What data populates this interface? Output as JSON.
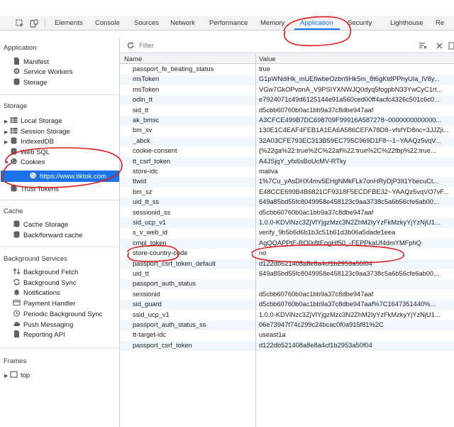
{
  "toolbar": {
    "tabs": [
      "Elements",
      "Console",
      "Sources",
      "Network",
      "Performance",
      "Memory",
      "Application",
      "Security",
      "Lighthouse",
      "Re"
    ],
    "active_tab": "Application",
    "filter_placeholder": "Filter",
    "accent": "#1a73e8",
    "annotation_color": "#e0191c"
  },
  "sidebar": {
    "application": {
      "title": "Application",
      "items": [
        {
          "label": "Manifest",
          "icon": "document-icon"
        },
        {
          "label": "Service Workers",
          "icon": "gear-icon"
        },
        {
          "label": "Storage",
          "icon": "database-icon"
        }
      ]
    },
    "storage": {
      "title": "Storage",
      "items": [
        {
          "label": "Local Storage",
          "icon": "grid-icon"
        },
        {
          "label": "Session Storage",
          "icon": "grid-icon"
        },
        {
          "label": "IndexedDB",
          "icon": "database-icon"
        },
        {
          "label": "Web SQL",
          "icon": "database-icon"
        },
        {
          "label": "Cookies",
          "icon": "cookie-icon"
        },
        {
          "label": "https://www.tiktok.com",
          "icon": "cookie-icon"
        },
        {
          "label": "Trust Tokens",
          "icon": "database-icon"
        }
      ]
    },
    "cache": {
      "title": "Cache",
      "items": [
        {
          "label": "Cache Storage",
          "icon": "database-icon"
        },
        {
          "label": "Back/forward cache",
          "icon": "database-icon"
        }
      ]
    },
    "background": {
      "title": "Background Services",
      "items": [
        {
          "label": "Background Fetch",
          "icon": "arrows-icon"
        },
        {
          "label": "Background Sync",
          "icon": "sync-icon"
        },
        {
          "label": "Notifications",
          "icon": "bell-icon"
        },
        {
          "label": "Payment Handler",
          "icon": "card-icon"
        },
        {
          "label": "Periodic Background Sync",
          "icon": "clock-icon"
        },
        {
          "label": "Push Messaging",
          "icon": "cloud-icon"
        },
        {
          "label": "Reporting API",
          "icon": "document-icon"
        }
      ]
    },
    "frames": {
      "title": "Frames",
      "items": [
        {
          "label": "top",
          "icon": "frame-icon"
        }
      ]
    }
  },
  "table": {
    "headers": {
      "name": "Name",
      "value": "Value"
    },
    "rows": [
      {
        "name": "passport_fe_beating_status",
        "value": "true"
      },
      {
        "name": "msToken",
        "value": "G1pWNdiHk_mUEfiwbeOzbn9Hk5m_8t6gKtdPPhyUla_lV8y..."
      },
      {
        "name": "msToken",
        "value": "VGw7GkOPvonA_V9PSIYXNWJQ0dyq5fogpbN33YwCyC1rt..."
      },
      {
        "name": "odin_tt",
        "value": "e7924071c49d6125144e91a560ced00ff4acfc4326c501c6c0..."
      },
      {
        "name": "sid_tt",
        "value": "d5cbb60760b0ac1bb9a37c8dbe947aaf"
      },
      {
        "name": "ak_bmsc",
        "value": "A3CFCE499B7DC698709F99916A587278~0000000000000..."
      },
      {
        "name": "bm_sv",
        "value": "130E1C4EAF4FEB1A1EA6A586CEFA78D8~vfsfYD8nc+3JJZji..."
      },
      {
        "name": "_abck",
        "value": "32A03CFE793EC313B59EC795C969D1F8~-1~YAAQz5vqV..."
      },
      {
        "name": "cookie-consent",
        "value": "{%22ga%22:true%2C%22af%22:true%2C%22fbp%22:true..."
      },
      {
        "name": "tt_csrf_token",
        "value": "A4JSjqY_yfx6sBoUcMV-RTky"
      },
      {
        "name": "store-idc",
        "value": "maliva"
      },
      {
        "name": "ttwid",
        "value": "1%7Cu_yAsDHX4mv5EHgNMkFLk7onHRyDjP3Il1YbecuCt..."
      },
      {
        "name": "bm_sz",
        "value": "E48CCE699B4B6821CF9318F5ECDFBE32~YAAQz5vqVO7vF..."
      },
      {
        "name": "uid_tt_ss",
        "value": "649a85bd55fc8049958e458123c9aa3738c5a6b56cfe6ab00..."
      },
      {
        "name": "sessionid_ss",
        "value": "d5cbb60760b0ac1bb9a37c8dbe947aaf"
      },
      {
        "name": "sid_ucp_v1",
        "value": "1.0.0-KDViNzc3ZjVlYjgzMzc3N2ZhM2IyYzFkMzkyYjYzNjU1..."
      },
      {
        "name": "s_v_web_id",
        "value": "verify_9b5b6d6b1b3c51b61d3b06a5dade1eea"
      },
      {
        "name": "cmpl_token",
        "value": "AgQQAPPtF-RO0r8tEogHf50_-FEPPkaUf4dmYMFphQ"
      },
      {
        "name": "store-country-code",
        "value": "no"
      },
      {
        "name": "passport_csrf_token_default",
        "value": "d122db521408a8e8a4cf1b2953a50f04"
      },
      {
        "name": "uid_tt",
        "value": "649a85bd55fc8049958e458123c9aa3738c5a6b56cfe6ab00..."
      },
      {
        "name": "passport_auth_status",
        "value": ""
      },
      {
        "name": "sessionid",
        "value": "d5cbb60760b0ac1bb9a37c8dbe947aaf"
      },
      {
        "name": "sid_guard",
        "value": "d5cbb60760b0ac1bb9a37c8dbe947aaf%7C1647351440%..."
      },
      {
        "name": "ssid_ucp_v1",
        "value": "1.0.0-KDViNzc3ZjVlYjgzMzc3N2ZhM2IyYzFkMzkyYjYzNjU1..."
      },
      {
        "name": "passport_auth_status_ss",
        "value": "06e73947f74c299c24bcac0f0a915f81%2C"
      },
      {
        "name": "tt-target-idc",
        "value": "useast1a"
      },
      {
        "name": "passport_csrf_token",
        "value": "d122db521408a8e8a4cf1b2953a50f04"
      }
    ]
  }
}
